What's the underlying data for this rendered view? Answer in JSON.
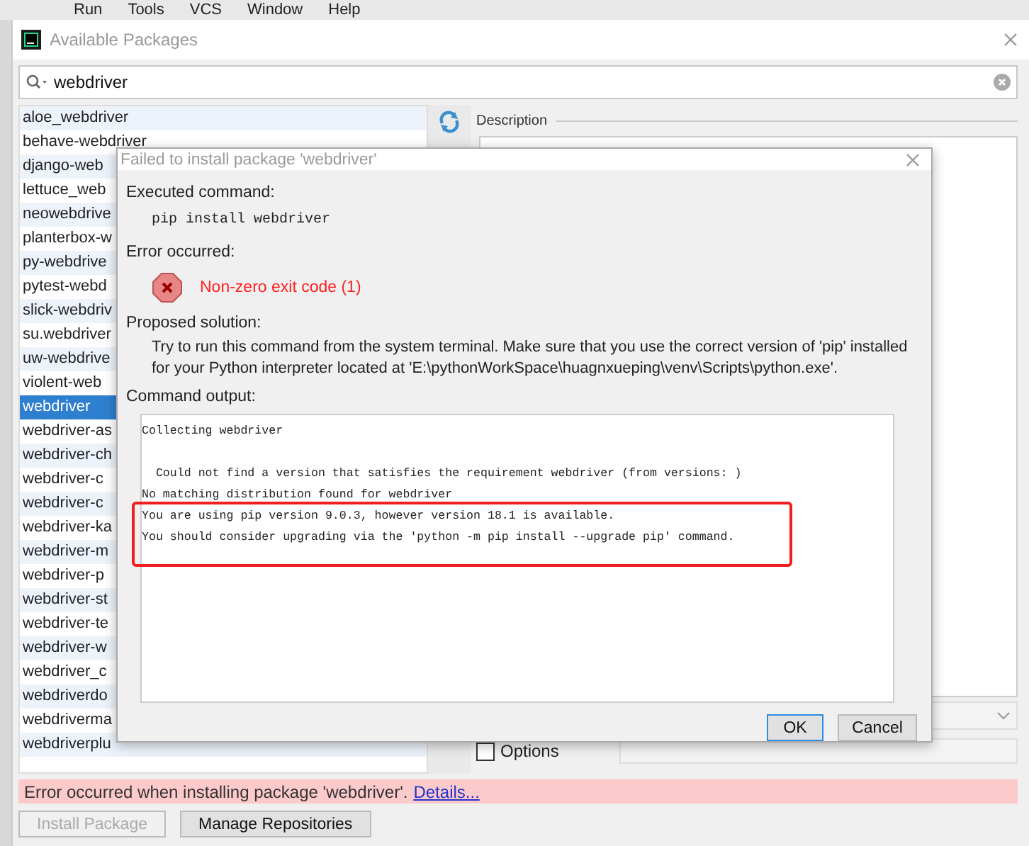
{
  "menu_bar": {
    "items": [
      "Run",
      "Tools",
      "VCS",
      "Window",
      "Help"
    ]
  },
  "window": {
    "title": "Available Packages"
  },
  "search": {
    "value": "webdriver"
  },
  "packages": [
    {
      "name": "aloe_webdriver",
      "selected": false
    },
    {
      "name": "behave-webdriver",
      "selected": false
    },
    {
      "name": "django-web",
      "selected": false
    },
    {
      "name": "lettuce_web",
      "selected": false
    },
    {
      "name": "neowebdrive",
      "selected": false
    },
    {
      "name": "planterbox-w",
      "selected": false
    },
    {
      "name": "py-webdrive",
      "selected": false
    },
    {
      "name": "pytest-webd",
      "selected": false
    },
    {
      "name": "slick-webdriv",
      "selected": false
    },
    {
      "name": "su.webdriver",
      "selected": false
    },
    {
      "name": "uw-webdrive",
      "selected": false
    },
    {
      "name": "violent-web",
      "selected": false
    },
    {
      "name": "webdriver",
      "selected": true
    },
    {
      "name": "webdriver-as",
      "selected": false
    },
    {
      "name": "webdriver-ch",
      "selected": false
    },
    {
      "name": "webdriver-c",
      "selected": false
    },
    {
      "name": "webdriver-c",
      "selected": false
    },
    {
      "name": "webdriver-ka",
      "selected": false
    },
    {
      "name": "webdriver-m",
      "selected": false
    },
    {
      "name": "webdriver-p",
      "selected": false
    },
    {
      "name": "webdriver-st",
      "selected": false
    },
    {
      "name": "webdriver-te",
      "selected": false
    },
    {
      "name": "webdriver-w",
      "selected": false
    },
    {
      "name": "webdriver_c",
      "selected": false
    },
    {
      "name": "webdriverdo",
      "selected": false
    },
    {
      "name": "webdriverma",
      "selected": false
    },
    {
      "name": "webdriverplu",
      "selected": false
    }
  ],
  "description": {
    "label": "Description"
  },
  "options": {
    "label": "Options",
    "checked": false
  },
  "error_bar": {
    "message": "Error occurred when installing package 'webdriver'.",
    "link": "Details..."
  },
  "buttons": [
    {
      "label": "Install Package",
      "disabled": true
    },
    {
      "label": "Manage Repositories",
      "disabled": false
    }
  ],
  "dialog": {
    "title": "Failed to install package 'webdriver'",
    "executed_label": "Executed command:",
    "command": "pip install webdriver",
    "error_label": "Error occurred:",
    "error_message": "Non-zero exit code (1)",
    "solution_label": "Proposed solution:",
    "solution_text": "Try to run this command from the system terminal. Make sure that you use the correct version of 'pip' installed for your Python interpreter located at 'E:\\pythonWorkSpace\\huagnxueping\\venv\\Scripts\\python.exe'.",
    "output_label": "Command output:",
    "output_blocks": [
      [
        "Collecting webdriver"
      ],
      [
        "  Could not find a version that satisfies the requirement webdriver (from versions: )",
        "No matching distribution found for webdriver",
        "You are using pip version 9.0.3, however version 18.1 is available.",
        "You should consider upgrading via the 'python -m pip install --upgrade pip' command."
      ]
    ],
    "buttons": [
      {
        "label": "OK",
        "default": true
      },
      {
        "label": "Cancel",
        "default": false
      }
    ]
  }
}
